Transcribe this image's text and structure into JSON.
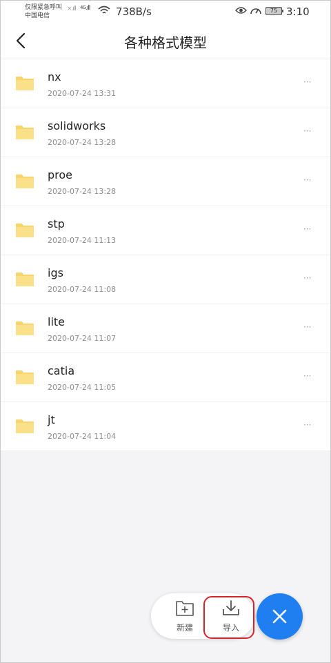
{
  "status_bar": {
    "carrier_line1": "仅限紧急呼叫",
    "carrier_line2": "中国电信",
    "network_type": "4G",
    "net_speed": "738B/s",
    "battery": "75",
    "time": "3:10"
  },
  "header": {
    "title": "各种格式模型"
  },
  "folders": [
    {
      "name": "nx",
      "date": "2020-07-24 13:31"
    },
    {
      "name": "solidworks",
      "date": "2020-07-24 13:28"
    },
    {
      "name": "proe",
      "date": "2020-07-24 13:28"
    },
    {
      "name": "stp",
      "date": "2020-07-24 11:13"
    },
    {
      "name": "igs",
      "date": "2020-07-24 11:08"
    },
    {
      "name": "lite",
      "date": "2020-07-24 11:07"
    },
    {
      "name": "catia",
      "date": "2020-07-24 11:05"
    },
    {
      "name": "jt",
      "date": "2020-07-24 11:04"
    }
  ],
  "more_label": "···",
  "actions": {
    "new_label": "新建",
    "import_label": "导入"
  },
  "icons": {
    "folder": "folder-icon",
    "back": "back-arrow-icon",
    "new": "new-folder-icon",
    "import": "download-icon",
    "close": "close-icon"
  },
  "colors": {
    "folder": "#f7d56a",
    "fab": "#1f7ef0",
    "highlight": "#d6222a"
  }
}
